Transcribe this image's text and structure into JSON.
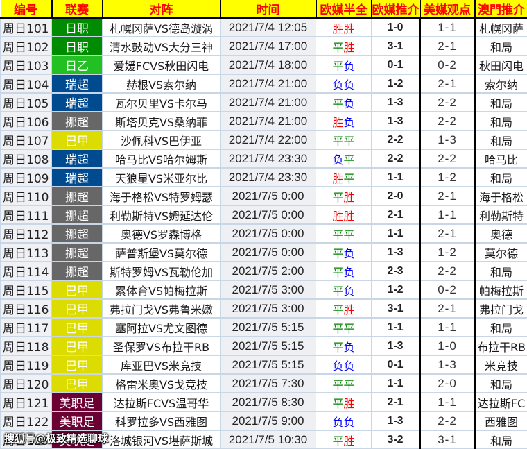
{
  "header": {
    "id": "编号",
    "league": "联赛",
    "match": "对阵",
    "time": "时间",
    "half_full": "欧媒半全",
    "eu_pick": "欧媒推介",
    "us_view": "美媒观点",
    "macau_pick": "澳門推介"
  },
  "colors": {
    "header_bg": "#ffff00",
    "header_text": "#ff0000",
    "win": "#ff0000",
    "draw": "#008000",
    "loss": "#0000ff"
  },
  "leagues": {
    "日职": "#008c00",
    "日乙": "#22c022",
    "瑞超": "#004a8f",
    "挪超": "#676767",
    "巴甲": "#dcdc00",
    "美职足": "#6b0033"
  },
  "rows": [
    {
      "id": "周日101",
      "league": "日职",
      "match": "札幌冈萨VS德岛漩涡",
      "time": "2021/7/4 12:05",
      "half_full": [
        "胜",
        "胜"
      ],
      "eu_pick": "1-0",
      "us_view": "1-1",
      "macau_pick": "札幌冈萨"
    },
    {
      "id": "周日102",
      "league": "日职",
      "match": "清水鼓动VS大分三神",
      "time": "2021/7/4 17:00",
      "half_full": [
        "平",
        "胜"
      ],
      "eu_pick": "3-1",
      "us_view": "2-1",
      "macau_pick": "和局"
    },
    {
      "id": "周日103",
      "league": "日乙",
      "match": "爱媛FCVS秋田闪电",
      "time": "2021/7/4 18:00",
      "half_full": [
        "平",
        "负"
      ],
      "eu_pick": "0-1",
      "us_view": "0-2",
      "macau_pick": "秋田闪电"
    },
    {
      "id": "周日104",
      "league": "瑞超",
      "match": "赫根VS索尔纳",
      "time": "2021/7/4 21:00",
      "half_full": [
        "负",
        "负"
      ],
      "eu_pick": "1-2",
      "us_view": "2-1",
      "macau_pick": "索尔纳"
    },
    {
      "id": "周日105",
      "league": "瑞超",
      "match": "瓦尔贝里VS卡尔马",
      "time": "2021/7/4 21:00",
      "half_full": [
        "平",
        "负"
      ],
      "eu_pick": "1-3",
      "us_view": "2-2",
      "macau_pick": "和局"
    },
    {
      "id": "周日106",
      "league": "挪超",
      "match": "斯塔贝克VS桑纳菲",
      "time": "2021/7/4 21:00",
      "half_full": [
        "胜",
        "负"
      ],
      "eu_pick": "1-3",
      "us_view": "2-2",
      "macau_pick": "和局"
    },
    {
      "id": "周日107",
      "league": "巴甲",
      "match": "沙佩科VS巴伊亚",
      "time": "2021/7/4 22:00",
      "half_full": [
        "平",
        "平"
      ],
      "eu_pick": "2-2",
      "us_view": "1-3",
      "macau_pick": "和局"
    },
    {
      "id": "周日108",
      "league": "瑞超",
      "match": "哈马比VS哈尔姆斯",
      "time": "2021/7/4 23:30",
      "half_full": [
        "负",
        "平"
      ],
      "eu_pick": "2-2",
      "us_view": "2-2",
      "macau_pick": "哈马比"
    },
    {
      "id": "周日109",
      "league": "瑞超",
      "match": "天狼星VS米亚尔比",
      "time": "2021/7/4 23:30",
      "half_full": [
        "胜",
        "平"
      ],
      "eu_pick": "1-1",
      "us_view": "1-2",
      "macau_pick": "和局"
    },
    {
      "id": "周日110",
      "league": "挪超",
      "match": "海于格松VS特罗姆瑟",
      "time": "2021/7/5 0:00",
      "half_full": [
        "平",
        "胜"
      ],
      "eu_pick": "2-0",
      "us_view": "2-1",
      "macau_pick": "海于格松"
    },
    {
      "id": "周日111",
      "league": "挪超",
      "match": "利勒斯特VS姆延达伦",
      "time": "2021/7/5 0:00",
      "half_full": [
        "胜",
        "胜"
      ],
      "eu_pick": "2-1",
      "us_view": "1-1",
      "macau_pick": "利勒斯特"
    },
    {
      "id": "周日112",
      "league": "挪超",
      "match": "奥德VS罗森博格",
      "time": "2021/7/5 0:00",
      "half_full": [
        "平",
        "平"
      ],
      "eu_pick": "1-1",
      "us_view": "2-1",
      "macau_pick": "奥德"
    },
    {
      "id": "周日113",
      "league": "挪超",
      "match": "萨普斯堡VS莫尔德",
      "time": "2021/7/5 0:00",
      "half_full": [
        "平",
        "负"
      ],
      "eu_pick": "1-3",
      "us_view": "1-2",
      "macau_pick": "莫尔德"
    },
    {
      "id": "周日114",
      "league": "挪超",
      "match": "斯特罗姆VS瓦勒伦加",
      "time": "2021/7/5 2:00",
      "half_full": [
        "平",
        "负"
      ],
      "eu_pick": "2-3",
      "us_view": "2-2",
      "macau_pick": "和局"
    },
    {
      "id": "周日115",
      "league": "巴甲",
      "match": "累体育VS帕梅拉斯",
      "time": "2021/7/5 3:00",
      "half_full": [
        "平",
        "负"
      ],
      "eu_pick": "1-2",
      "us_view": "0-2",
      "macau_pick": "帕梅拉斯"
    },
    {
      "id": "周日116",
      "league": "巴甲",
      "match": "弗拉门戈VS弗鲁米嫩",
      "time": "2021/7/5 3:00",
      "half_full": [
        "平",
        "胜"
      ],
      "eu_pick": "3-1",
      "us_view": "2-1",
      "macau_pick": "弗拉门戈"
    },
    {
      "id": "周日117",
      "league": "巴甲",
      "match": "塞阿拉VS尤文图德",
      "time": "2021/7/5 5:15",
      "half_full": [
        "平",
        "平"
      ],
      "eu_pick": "1-1",
      "us_view": "1-1",
      "macau_pick": "和局"
    },
    {
      "id": "周日118",
      "league": "巴甲",
      "match": "圣保罗VS布拉干RB",
      "time": "2021/7/5 5:15",
      "half_full": [
        "平",
        "负"
      ],
      "eu_pick": "1-3",
      "us_view": "1-0",
      "macau_pick": "布拉干RB"
    },
    {
      "id": "周日119",
      "league": "巴甲",
      "match": "库亚巴VS米竞技",
      "time": "2021/7/5 5:15",
      "half_full": [
        "负",
        "负"
      ],
      "eu_pick": "0-1",
      "us_view": "1-3",
      "macau_pick": "米竞技"
    },
    {
      "id": "周日120",
      "league": "巴甲",
      "match": "格雷米奥VS戈竞技",
      "time": "2021/7/5 7:30",
      "half_full": [
        "平",
        "平"
      ],
      "eu_pick": "1-1",
      "us_view": "2-0",
      "macau_pick": "和局"
    },
    {
      "id": "周日121",
      "league": "美职足",
      "match": "达拉斯FCVS温哥华",
      "time": "2021/7/5 8:30",
      "half_full": [
        "平",
        "胜"
      ],
      "eu_pick": "2-1",
      "us_view": "1-1",
      "macau_pick": "达拉斯FC"
    },
    {
      "id": "周日122",
      "league": "美职足",
      "match": "科罗拉多VS西雅图",
      "time": "2021/7/5 9:00",
      "half_full": [
        "负",
        "负"
      ],
      "eu_pick": "1-3",
      "us_view": "2-2",
      "macau_pick": "西雅图"
    },
    {
      "id": "周日123",
      "league": "美职足",
      "match": "洛城银河VS堪萨斯城",
      "time": "2021/7/5 10:30",
      "half_full": [
        "平",
        "胜"
      ],
      "eu_pick": "3-2",
      "us_view": "3-1",
      "macau_pick": "和局"
    }
  ],
  "watermark": "搜狐号@极致精选聊球"
}
